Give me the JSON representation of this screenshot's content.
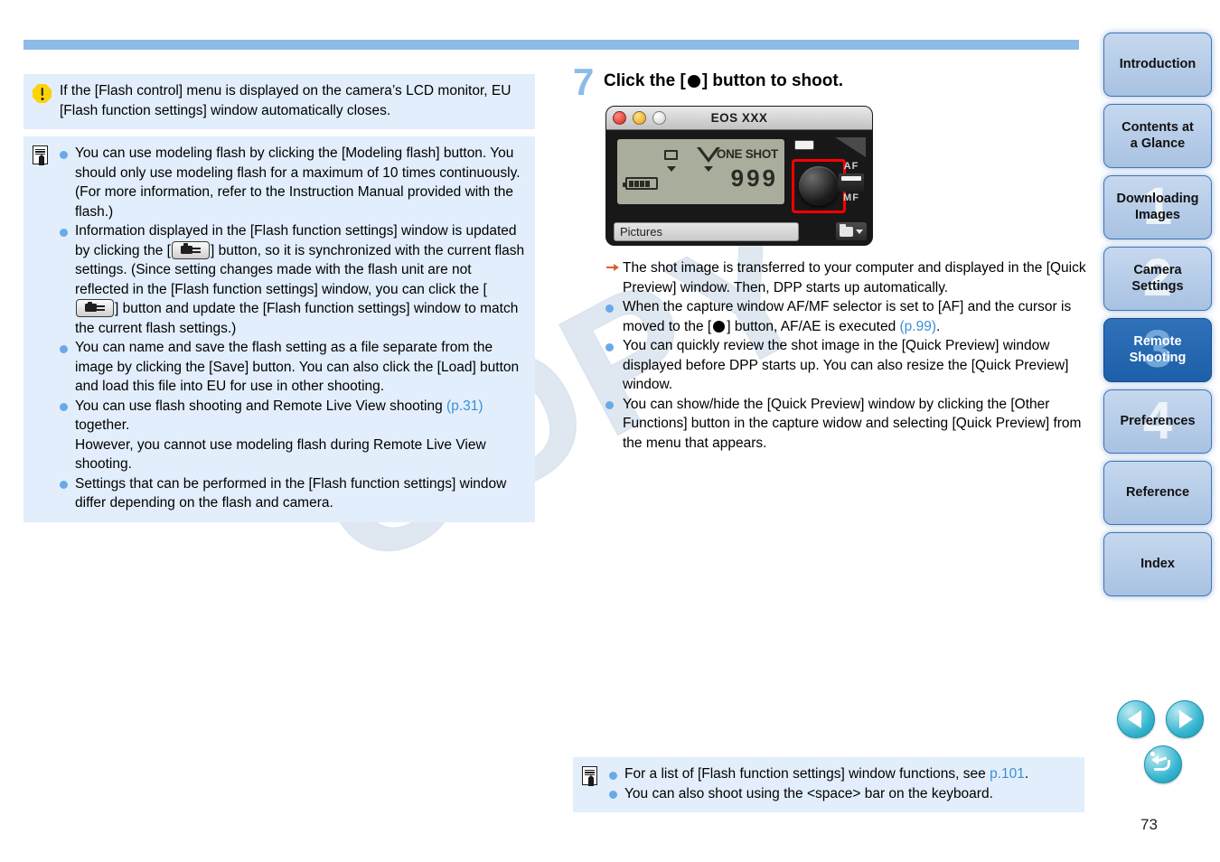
{
  "page": {
    "number": "73",
    "watermark": "COPY"
  },
  "left_column": {
    "warning_note": {
      "icon": "warning-octagon-icon",
      "text": "If the [Flash control] menu is displayed on the camera’s LCD monitor, EU [Flash function settings] window automatically closes."
    },
    "memo_note": {
      "icon": "memo-pen-icon",
      "items": [
        {
          "parts": [
            {
              "type": "text",
              "value": "You can use modeling flash by clicking the [Modeling flash] button. You should only use modeling flash for a maximum of 10 times continuously. (For more information, refer to the Instruction Manual provided with the flash.)"
            }
          ]
        },
        {
          "parts": [
            {
              "type": "text",
              "value": "Information displayed in the [Flash function settings] window is updated by clicking the ["
            },
            {
              "type": "icon",
              "value": "camera-sync-button-icon"
            },
            {
              "type": "text",
              "value": "] button, so it is synchronized with the current flash settings. (Since setting changes made with the flash unit are not reflected in the [Flash function settings] window, you can click the ["
            },
            {
              "type": "icon",
              "value": "camera-sync-button-icon"
            },
            {
              "type": "text",
              "value": "] button and update the [Flash function settings] window to match the current flash settings.)"
            }
          ]
        },
        {
          "parts": [
            {
              "type": "text",
              "value": "You can name and save the flash setting as a file separate from the image by clicking the [Save] button. You can also click the [Load] button and load this file into EU for use in other shooting."
            }
          ]
        },
        {
          "parts": [
            {
              "type": "text",
              "value": "You can use flash shooting and Remote Live View shooting "
            },
            {
              "type": "link",
              "value": "(p.31)"
            },
            {
              "type": "text",
              "value": " together."
            },
            {
              "type": "break",
              "value": ""
            },
            {
              "type": "text",
              "value": "However, you cannot use modeling flash during Remote Live View shooting."
            }
          ]
        },
        {
          "parts": [
            {
              "type": "text",
              "value": "Settings that can be performed in the [Flash function settings] window differ depending on the flash and camera."
            }
          ]
        }
      ]
    }
  },
  "right_column": {
    "step": {
      "number": "7",
      "title_before": "Click the [",
      "title_icon": "shutter-dot-icon",
      "title_after": "] button to shoot."
    },
    "capture_window": {
      "title": "EOS XXX",
      "traffic_lights": [
        "close-button",
        "minimize-button",
        "zoom-button"
      ],
      "lcd": {
        "mode": "ONE SHOT",
        "shots_remaining": "999",
        "battery_icon": "battery-full-icon",
        "frame_icon": "single-frame-icon",
        "meter_icon": "exposure-triangle-icon"
      },
      "shutter_button": "shutter-release-button",
      "afmf_selector": {
        "top_label": "AF",
        "bottom_label": "MF",
        "selected": "AF"
      },
      "folder_button": "destination-folder-button",
      "destination_field": "Pictures"
    },
    "results": [
      {
        "marker": "arrow",
        "parts": [
          {
            "type": "text",
            "value": "The shot image is transferred to your computer and displayed in the [Quick Preview] window. Then, DPP starts up automatically."
          }
        ]
      },
      {
        "marker": "dot",
        "parts": [
          {
            "type": "text",
            "value": "When the capture window AF/MF selector is set to [AF] and the cursor is moved to the ["
          },
          {
            "type": "icon",
            "value": "shutter-dot-icon"
          },
          {
            "type": "text",
            "value": "] button, AF/AE is executed "
          },
          {
            "type": "link",
            "value": "(p.99)"
          },
          {
            "type": "text",
            "value": "."
          }
        ]
      },
      {
        "marker": "dot",
        "parts": [
          {
            "type": "text",
            "value": "You can quickly review the shot image in the [Quick Preview] window displayed before DPP starts up. You can also resize the [Quick Preview] window."
          }
        ]
      },
      {
        "marker": "dot",
        "parts": [
          {
            "type": "text",
            "value": "You can show/hide the [Quick Preview] window by clicking the [Other Functions] button in the capture widow and selecting [Quick Preview] from the menu that appears."
          }
        ]
      }
    ],
    "bottom_note": {
      "icon": "memo-pen-icon",
      "items": [
        {
          "parts": [
            {
              "type": "text",
              "value": "For a list of [Flash function settings] window functions, see "
            },
            {
              "type": "link",
              "value": "p.101"
            },
            {
              "type": "text",
              "value": "."
            }
          ]
        },
        {
          "parts": [
            {
              "type": "text",
              "value": "You can also shoot using the <space> bar on the keyboard."
            }
          ]
        }
      ]
    }
  },
  "sidebar": {
    "tabs": [
      {
        "label": "Introduction",
        "watermark": "",
        "active": false
      },
      {
        "label": "Contents at\na Glance",
        "watermark": "",
        "active": false
      },
      {
        "label": "Downloading\nImages",
        "watermark": "1",
        "active": false
      },
      {
        "label": "Camera\nSettings",
        "watermark": "2",
        "active": false
      },
      {
        "label": "Remote\nShooting",
        "watermark": "3",
        "active": true
      },
      {
        "label": "Preferences",
        "watermark": "4",
        "active": false
      },
      {
        "label": "Reference",
        "watermark": "",
        "active": false
      },
      {
        "label": "Index",
        "watermark": "",
        "active": false
      }
    ],
    "nav_buttons": [
      {
        "name": "previous-page-button"
      },
      {
        "name": "next-page-button"
      },
      {
        "name": "return-button"
      }
    ]
  },
  "colors": {
    "accent_bar": "#8cbbe8",
    "note_bg": "#e2eefb",
    "link": "#3b8fd6",
    "bullet": "#6aa9e9",
    "active_tab": "#2f72ba",
    "warning": "#fcd209"
  }
}
